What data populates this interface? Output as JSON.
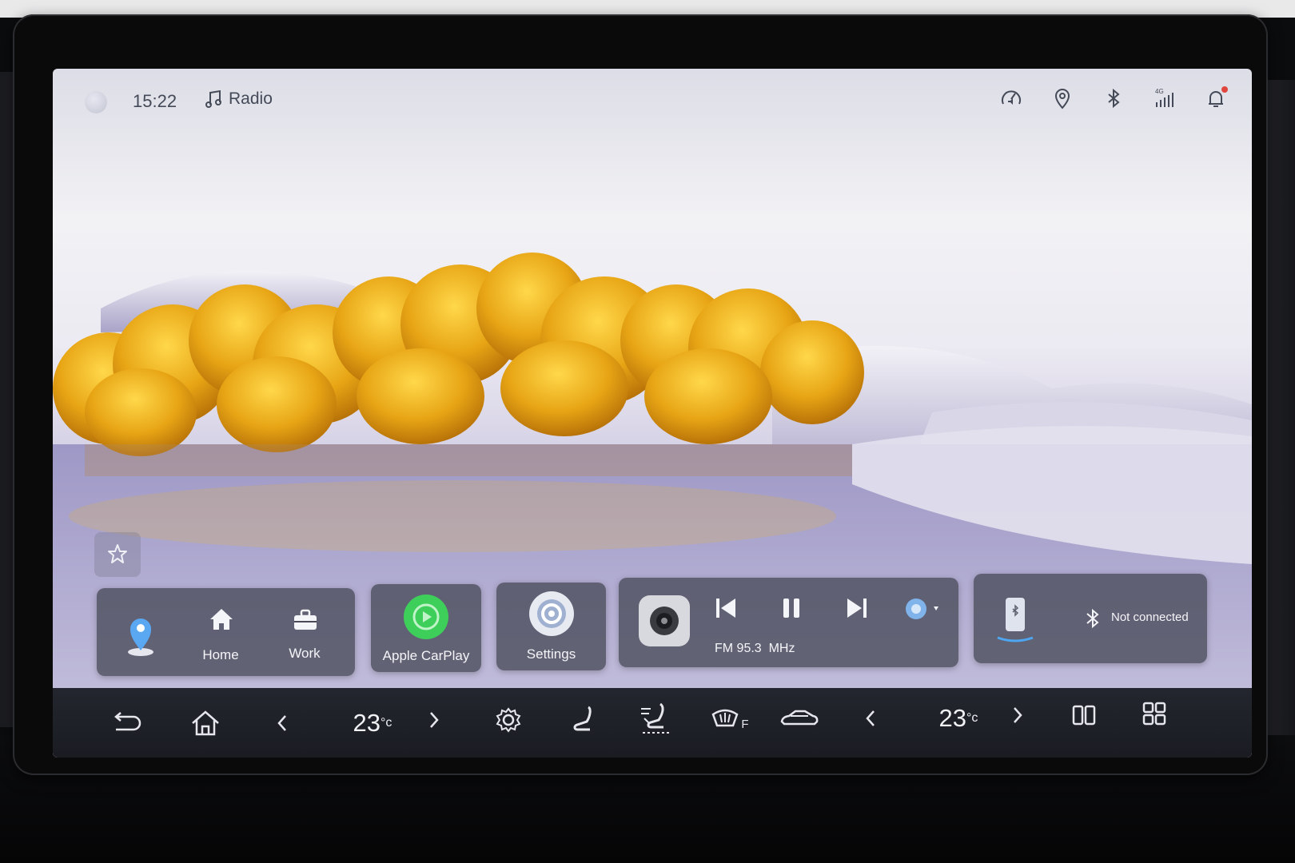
{
  "status_bar": {
    "time": "15:22",
    "media_source": "Radio",
    "icons": [
      "speed-sound-icon",
      "location-pin-icon",
      "bluetooth-icon",
      "4g-signal-icon",
      "notification-bell-icon"
    ],
    "signal_label": "4G"
  },
  "widget_button_icon": "star-edit-icon",
  "dock": {
    "navigation": {
      "home_label": "Home",
      "work_label": "Work"
    },
    "carplay_label": "Apple CarPlay",
    "settings_label": "Settings",
    "radio": {
      "station": "FM 95.3  MHz",
      "controls": [
        "previous-icon",
        "pause-icon",
        "next-icon"
      ]
    },
    "bluetooth_status": "Not connected"
  },
  "bottom_bar": {
    "left_temp": "23",
    "right_temp": "23",
    "temp_unit": "°c",
    "defrost_label": "F"
  },
  "colors": {
    "accent_green": "#3ecf5a",
    "card_bg": "#484a58",
    "bar_bg": "#1e2027",
    "notification_red": "#e0463e"
  }
}
